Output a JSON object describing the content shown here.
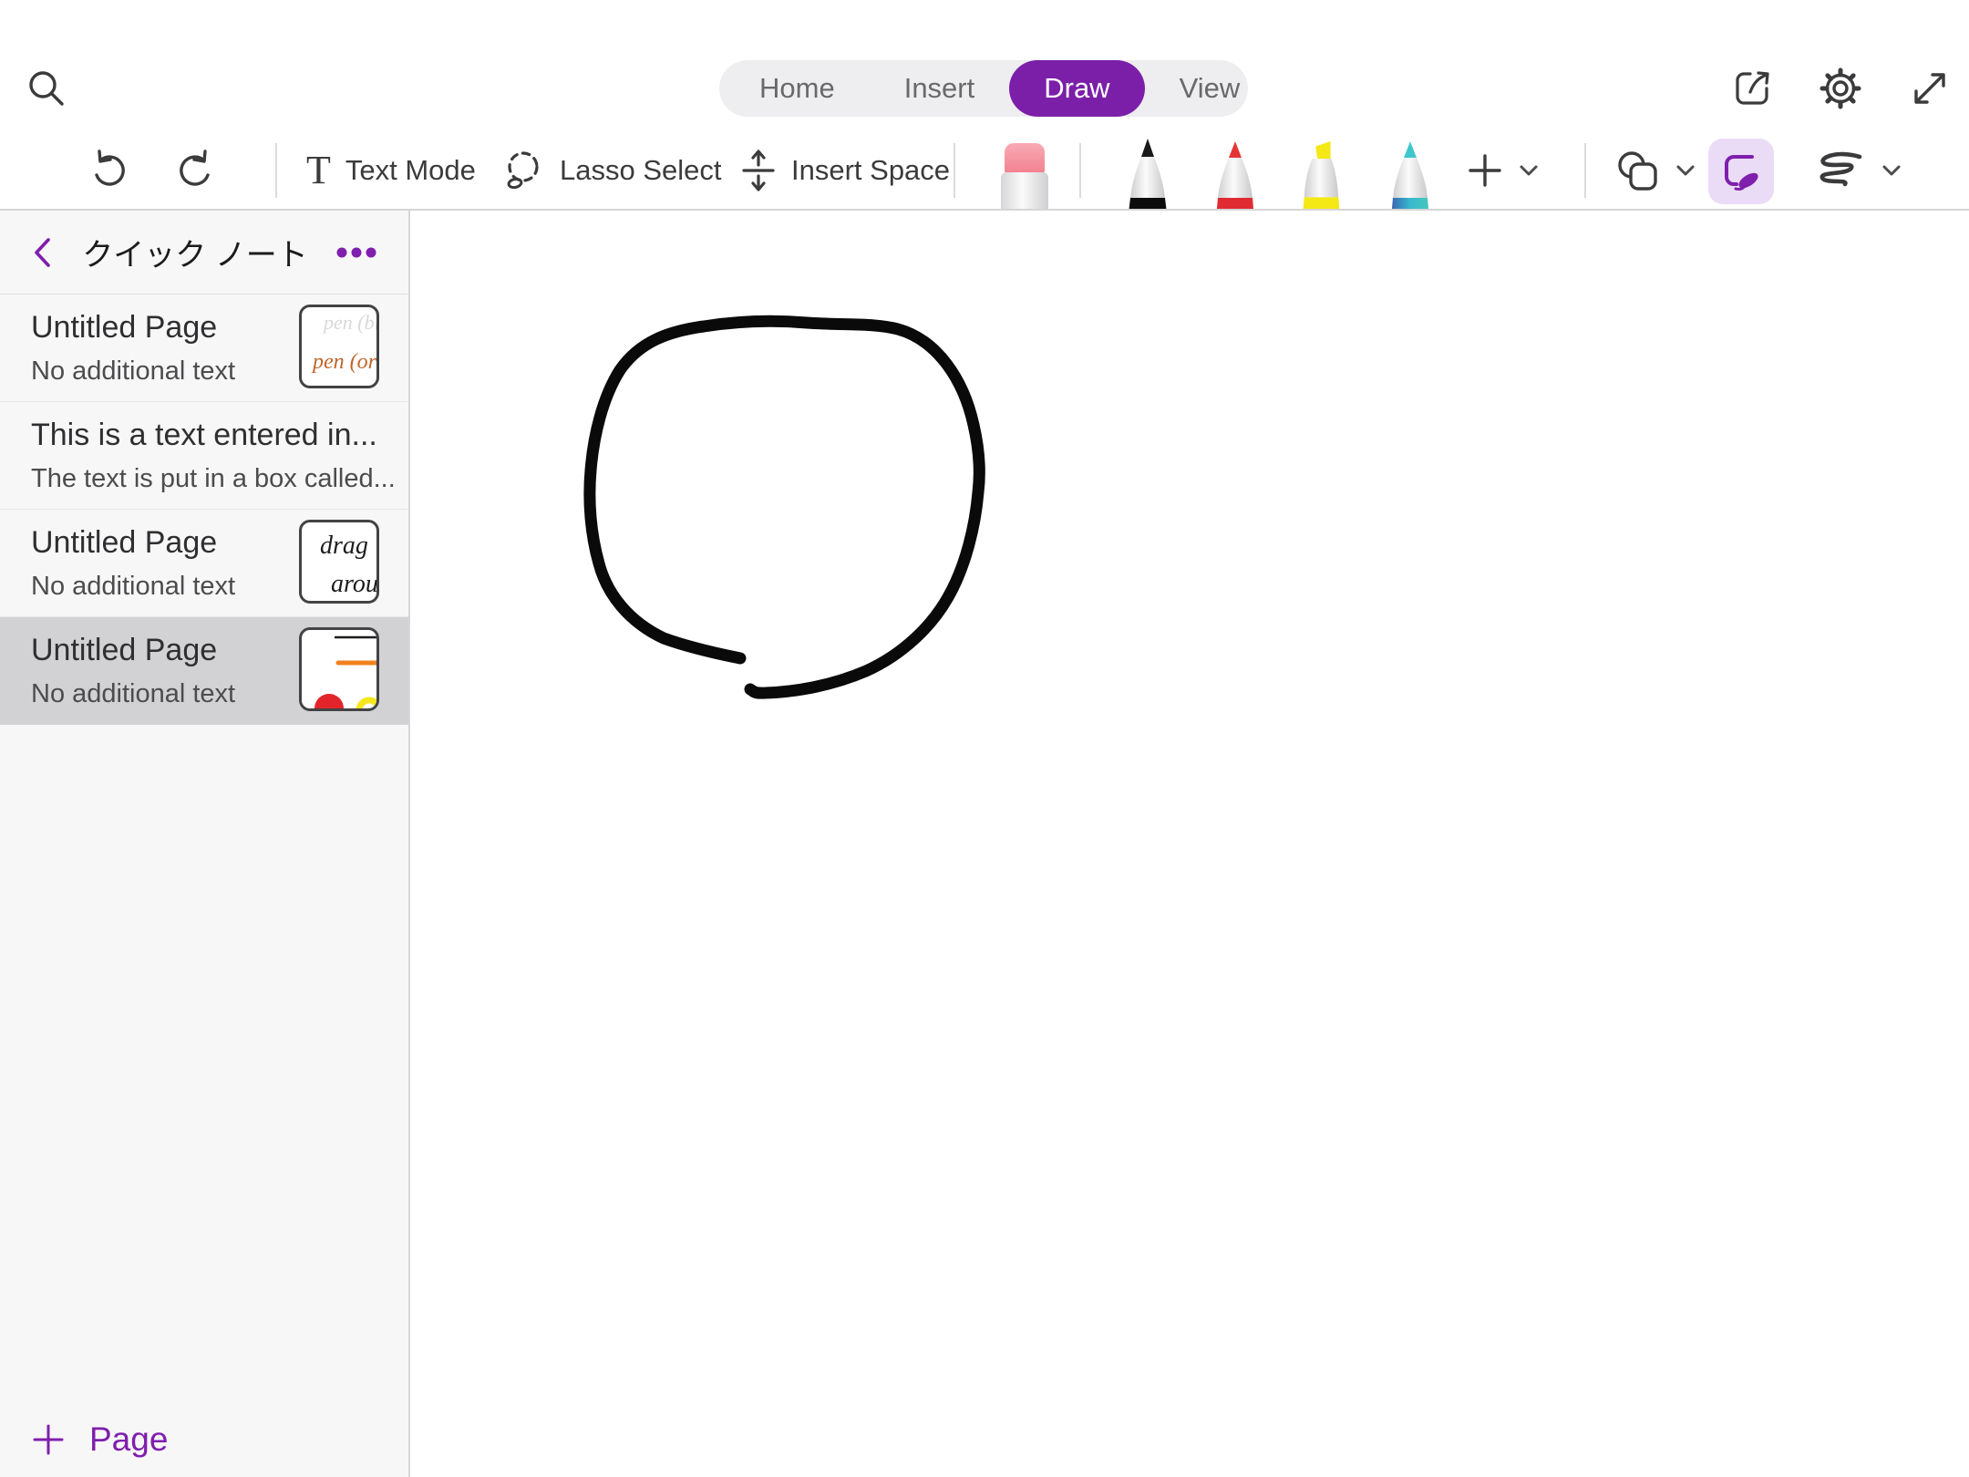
{
  "topbar": {
    "tabs": [
      {
        "label": "Home",
        "active": false
      },
      {
        "label": "Insert",
        "active": false
      },
      {
        "label": "Draw",
        "active": true
      },
      {
        "label": "View",
        "active": false
      }
    ]
  },
  "toolbar": {
    "text_mode_label": "Text Mode",
    "text_mode_glyph": "T",
    "lasso_label": "Lasso Select",
    "insert_space_label": "Insert Space",
    "tools": [
      "undo",
      "redo",
      "eraser",
      "black-pen",
      "red-pen",
      "yellow-highlighter",
      "teal-pen",
      "add-pen",
      "shapes",
      "ink-to-shape",
      "ink-stroke"
    ]
  },
  "sidebar": {
    "notebook_title": "クイック ノート",
    "items": [
      {
        "title": "Untitled Page",
        "subtitle": "No additional text",
        "thumbnail_text": [
          "pen (bl",
          "pen (ora"
        ],
        "selected": false
      },
      {
        "title": "This is a text entered in...",
        "subtitle": "The text is put in a box called...",
        "selected": false
      },
      {
        "title": "Untitled Page",
        "subtitle": "No additional text",
        "thumbnail_text": [
          "drag",
          "arou"
        ],
        "selected": false
      },
      {
        "title": "Untitled Page",
        "subtitle": "No additional text",
        "selected": true
      }
    ],
    "add_page_label": "Page"
  },
  "canvas": {
    "ink": {
      "shape": "hand-drawn open circle",
      "color": "#0a0a0a"
    }
  },
  "colors": {
    "accent_purple": "#7f1fad",
    "active_tab_bg": "#7b1fa8",
    "tab_bar_bg": "#eeedef",
    "selected_item_bg": "#d2d1d3",
    "ink_shape_btn_bg": "#eadcf6",
    "eraser_pink": "#f2808f",
    "pen_red": "#e02b33",
    "highlighter_yellow": "#f4e816",
    "pen_teal": "#3fc6cc",
    "thumb_orange": "#c06428"
  }
}
